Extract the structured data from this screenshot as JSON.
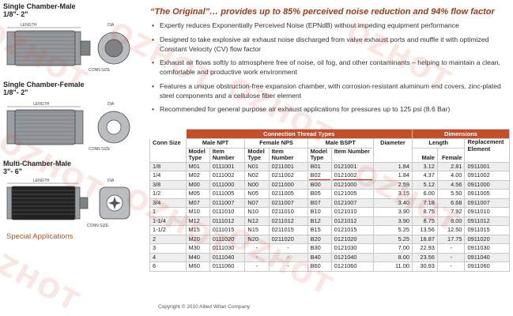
{
  "left": {
    "sections": [
      {
        "title": "Single Chamber-Male",
        "size": "1/8\"- 2\"",
        "length_label": "LENGTH",
        "dia_label": "DIA",
        "conn_label": "CONN SIZE"
      },
      {
        "title": "Single Chamber-Female",
        "size": "1/8\"- 2\"",
        "length_label": "LENGTH",
        "dia_label": "DIA",
        "conn_label": "CONN SIZE"
      },
      {
        "title": "Multi-Chamber-Male",
        "size": "3\"- 6\"",
        "length_label": "LENGTH",
        "dia_label": "DIA",
        "conn_label": "CONN SIZE"
      }
    ],
    "special_link": "Special Applications"
  },
  "headline": "“The Original”… provides up to 85% perceived noise reduction and 94% flow factor",
  "bullets": [
    "Expertly reduces Exponentially Perceived Noise (EPNdB) without impeding equipment performance",
    "Designed to take explosive air exhaust noise discharged from valve exhaust ports and muffle it with optimized Constant Velocity (CV) flow factor",
    "Exhaust air flows softly to atmosphere free of noise, oil fog, and other contaminants – helping to maintain a clean, comfortable and productive work environment",
    "Features a unique obstruction-free expansion chamber, with corrosion-resistant aluminum end covers, zinc-plated steel components and a cellulose fiber element",
    "Recommended for general purpose air exhaust applications for pressures up to 125 psi (8.6 Bar)"
  ],
  "table": {
    "band_connection": "Connection Thread Types",
    "band_dimensions": "Dimensions",
    "headers": {
      "conn_size": "Conn Size",
      "male_npt": "Male NPT",
      "female_nps": "Female NPS",
      "male_bspt": "Male BSPT",
      "diameter": "Diameter",
      "length": "Length",
      "replacement": "Replacement Element",
      "model_type": "Model Type",
      "item_number": "Item Number",
      "male": "Male",
      "female": "Female"
    },
    "rows": [
      [
        "1/8",
        "M01",
        "0111001",
        "N01",
        "0211001",
        "B01",
        "0121001",
        "1.84",
        "3.12",
        "2.81",
        "0911001"
      ],
      [
        "1/4",
        "M02",
        "0111002",
        "N02",
        "0211002",
        "B02",
        "0121002",
        "1.84",
        "4.37",
        "4.00",
        "0911002"
      ],
      [
        "3/8",
        "M00",
        "0111000",
        "N00",
        "0211000",
        "B00",
        "0121000",
        "2.59",
        "5.12",
        "4.56",
        "0911000"
      ],
      [
        "1/2",
        "M05",
        "0111005",
        "N05",
        "0211005",
        "B05",
        "0121005",
        "3.15",
        "6.00",
        "5.50",
        "0911005"
      ],
      [
        "3/4",
        "M07",
        "0111007",
        "N07",
        "0211007",
        "B07",
        "0121007",
        "3.40",
        "7.18",
        "6.68",
        "0911007"
      ],
      [
        "1",
        "M10",
        "0111010",
        "N10",
        "0211010",
        "B10",
        "0121010",
        "3.90",
        "8.75",
        "7.92",
        "0911010"
      ],
      [
        "1-1/4",
        "M12",
        "0111012",
        "N12",
        "0211012",
        "B12",
        "0121012",
        "3.90",
        "8.75",
        "8.00",
        "0911012"
      ],
      [
        "1-1/2",
        "M15",
        "0111015",
        "N15",
        "0211015",
        "B15",
        "0121015",
        "5.25",
        "13.56",
        "12.50",
        "0911015"
      ],
      [
        "2",
        "M20",
        "0111020",
        "N20",
        "0211020",
        "B20",
        "0121020",
        "5.25",
        "18.87",
        "17.75",
        "0911020"
      ],
      [
        "3",
        "M30",
        "0111030",
        "-",
        "-",
        "B30",
        "0121030",
        "7.00",
        "22.93",
        "-",
        "0911030"
      ],
      [
        "4",
        "M40",
        "0111040",
        "-",
        "-",
        "B40",
        "0121040",
        "8.00",
        "23.56",
        "-",
        "0911040"
      ],
      [
        "6",
        "M60",
        "0111060",
        "-",
        "-",
        "B60",
        "0121060",
        "11.00",
        "30.93",
        "-",
        "0911060"
      ]
    ],
    "highlighted_row": 1
  },
  "copyright": "Copyright © 2010 Allied Witan Company",
  "watermark": "OZHOT",
  "colors": {
    "accent": "#c54d28",
    "headline": "#9a3b1c",
    "link": "#b3541e",
    "highlight_underline": "#d02020"
  }
}
